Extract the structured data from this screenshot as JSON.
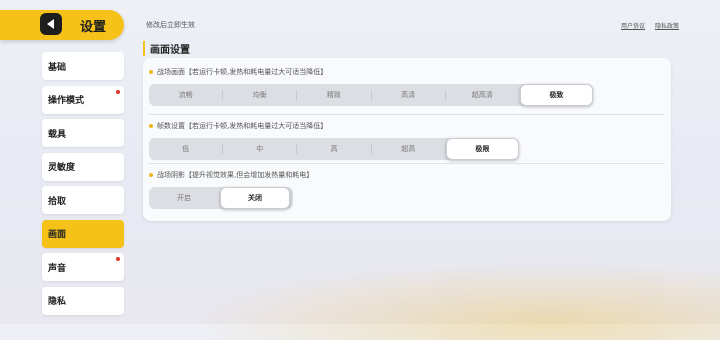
{
  "header": {
    "title": "设置",
    "notice": "修改后立即生效"
  },
  "top_links": [
    "用户协议",
    "隐私政策"
  ],
  "sidebar": {
    "items": [
      {
        "label": "基础",
        "dot": false,
        "active": false
      },
      {
        "label": "操作模式",
        "dot": true,
        "active": false
      },
      {
        "label": "载具",
        "dot": false,
        "active": false
      },
      {
        "label": "灵敏度",
        "dot": false,
        "active": false
      },
      {
        "label": "拾取",
        "dot": false,
        "active": false
      },
      {
        "label": "画面",
        "dot": false,
        "active": true
      },
      {
        "label": "声音",
        "dot": true,
        "active": false
      },
      {
        "label": "隐私",
        "dot": false,
        "active": false
      }
    ]
  },
  "section": {
    "title": "画面设置"
  },
  "settings": [
    {
      "label": "战场画面【若运行卡顿,发热和耗电量过大可适当降低】",
      "options": [
        "流畅",
        "均衡",
        "精致",
        "高清",
        "超高清",
        "极致"
      ],
      "selected": 5
    },
    {
      "label": "帧数设置【若运行卡顿,发热和耗电量过大可适当降低】",
      "options": [
        "低",
        "中",
        "高",
        "超高",
        "极限"
      ],
      "selected": 4
    },
    {
      "label": "战场阴影【提升视觉效果,但会增加发热量和耗电】",
      "options": [
        "开启",
        "关闭"
      ],
      "selected": 1
    }
  ],
  "colors": {
    "accent": "#f6c21a",
    "dot": "#e0342b",
    "panel": "#fafbfd"
  }
}
